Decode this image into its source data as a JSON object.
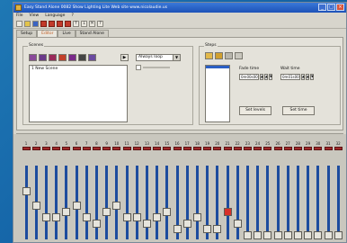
{
  "window": {
    "title": "Easy Stand Alone 0082 Show Lighting Lite Web site www.nicolaudie.us"
  },
  "menu": [
    "File",
    "View",
    "Language",
    "?"
  ],
  "tabs": [
    {
      "label": "Setup"
    },
    {
      "label": "Editor"
    },
    {
      "label": "Live"
    },
    {
      "label": "Stand Alone"
    }
  ],
  "scenes": {
    "label": "Scenes",
    "items": [
      "1 New Scene"
    ],
    "dropdown_value": "Always loop"
  },
  "steps": {
    "label": "Steps",
    "fade_time_label": "Fade time",
    "fade_time_value": "0m00s00",
    "wait_time_label": "Wait time",
    "wait_time_value": "0m01s00",
    "set_levels_label": "Set levels",
    "set_time_label": "Set time"
  },
  "channels": [
    "1",
    "2",
    "3",
    "4",
    "5",
    "6",
    "7",
    "8",
    "9",
    "10",
    "11",
    "12",
    "13",
    "14",
    "15",
    "16",
    "17",
    "18",
    "19",
    "20",
    "21",
    "22",
    "23",
    "24",
    "25",
    "26",
    "27",
    "28",
    "29",
    "30",
    "31",
    "32"
  ],
  "fader_levels": [
    0.67,
    0.45,
    0.27,
    0.27,
    0.36,
    0.45,
    0.27,
    0.18,
    0.36,
    0.45,
    0.27,
    0.27,
    0.18,
    0.27,
    0.36,
    0.09,
    0.18,
    0.27,
    0.09,
    0.09,
    0.36,
    0.18,
    0.0,
    0.0,
    0.0,
    0.0,
    0.0,
    0.0,
    0.0,
    0.0,
    0.0,
    0.0
  ],
  "selected_channel_index": 20,
  "colors": {
    "fader_track": "#1d4c9e",
    "selected_knob": "#d8302a",
    "title_bar": "#2a63c8"
  }
}
